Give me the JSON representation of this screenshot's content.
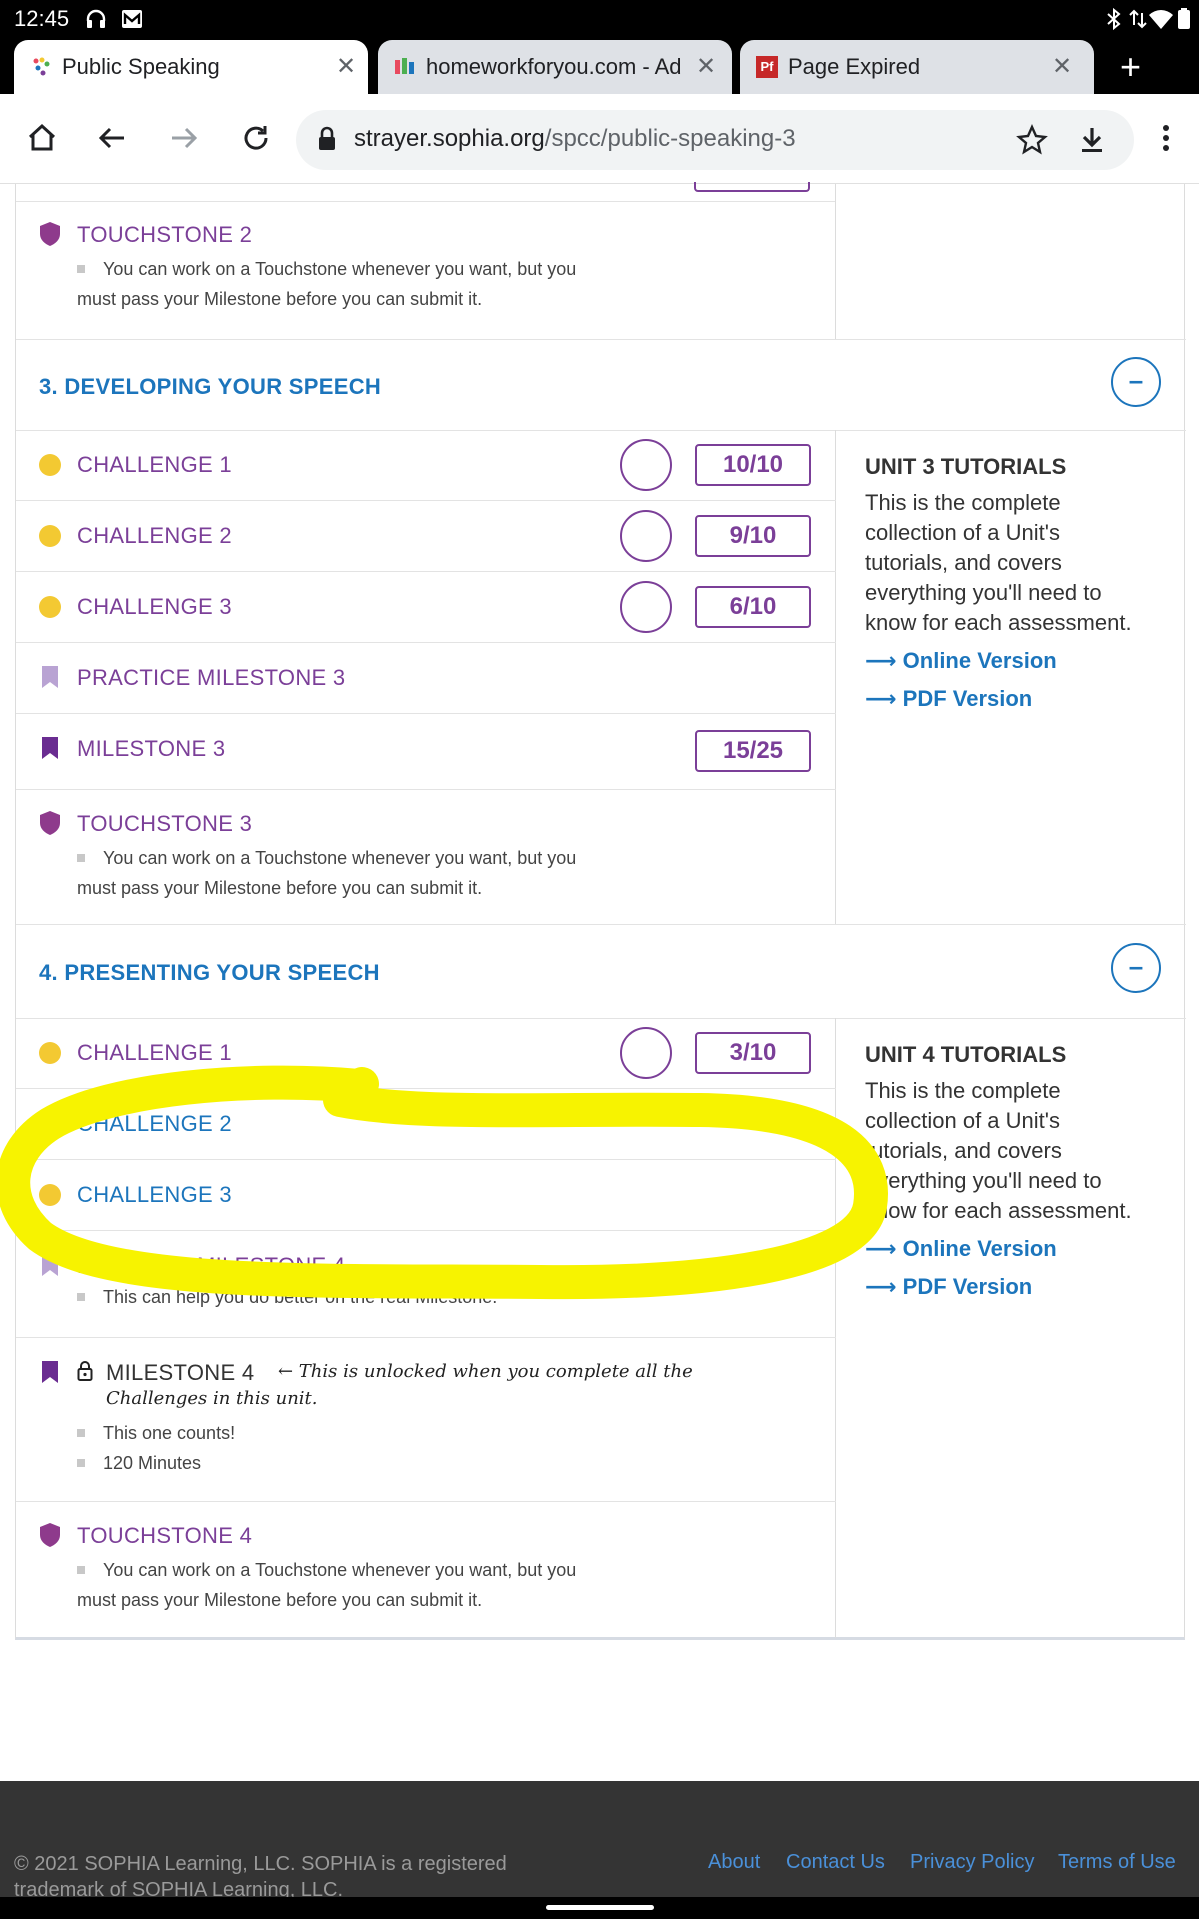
{
  "status": {
    "time": "12:45"
  },
  "tabs": [
    {
      "label": "Public Speaking",
      "active": true
    },
    {
      "label": "homeworkforyou.com - Add",
      "active": false
    },
    {
      "label": "Page Expired",
      "active": false,
      "favicon_text": "Pf"
    }
  ],
  "toolbar": {
    "url_domain": "strayer.sophia.org",
    "url_path": "/spcc/public-speaking-3"
  },
  "unit2": {
    "touchstone": {
      "title": "TOUCHSTONE 2",
      "note_line1": "You can work on a Touchstone whenever you want, but you",
      "note_line2": "must pass your Milestone before you can submit it."
    }
  },
  "unit3": {
    "heading": "3. DEVELOPING YOUR SPEECH",
    "collapse_label": "–",
    "items": [
      {
        "title": "CHALLENGE 1",
        "score": "10/10"
      },
      {
        "title": "CHALLENGE 2",
        "score": "9/10"
      },
      {
        "title": "CHALLENGE 3",
        "score": "6/10"
      },
      {
        "title": "PRACTICE MILESTONE 3"
      },
      {
        "title": "MILESTONE 3",
        "score": "15/25"
      }
    ],
    "touchstone": {
      "title": "TOUCHSTONE 3",
      "note_line1": "You can work on a Touchstone whenever you want, but you",
      "note_line2": "must pass your Milestone before you can submit it."
    },
    "tutorials": {
      "title": "UNIT 3 TUTORIALS",
      "desc_lines": [
        "This is the complete",
        "collection of a Unit's",
        "tutorials, and covers",
        "everything you'll need to",
        "know for each assessment."
      ],
      "online": "⟶ Online Version",
      "pdf": "⟶ PDF Version"
    }
  },
  "unit4": {
    "heading": "4. PRESENTING YOUR SPEECH",
    "collapse_label": "–",
    "items": [
      {
        "title": "CHALLENGE 1",
        "score": "3/10"
      },
      {
        "title": "CHALLENGE 2"
      },
      {
        "title": "CHALLENGE 3"
      }
    ],
    "practice": {
      "title": "PRACTICE MILESTONE 4",
      "note": "This can help you do better on the real Milestone."
    },
    "milestone": {
      "title": "MILESTONE 4",
      "annotation_line1": "← This is unlocked when you complete all the",
      "annotation_line2": "Challenges in this unit.",
      "note1": "This one counts!",
      "note2": "120 Minutes"
    },
    "touchstone": {
      "title": "TOUCHSTONE 4",
      "note_line1": "You can work on a Touchstone whenever you want, but you",
      "note_line2": "must pass your Milestone before you can submit it."
    },
    "tutorials": {
      "title": "UNIT 4 TUTORIALS",
      "desc_lines": [
        "This is the complete",
        "collection of a Unit's",
        "tutorials, and covers",
        "everything you'll need to",
        "know for each assessment."
      ],
      "online": "⟶ Online Version",
      "pdf": "⟶ PDF Version"
    }
  },
  "footer": {
    "copyright": "© 2021 SOPHIA Learning, LLC. SOPHIA is a registered trademark of SOPHIA Learning, LLC.",
    "links": [
      "About",
      "Contact Us",
      "Privacy Policy",
      "Terms of Use"
    ]
  },
  "colors": {
    "purple": "#7b3f98",
    "blue": "#1c75bc",
    "yellow_dot": "#f3c932",
    "highlight": "#f7f300",
    "footer_bg": "#343434"
  },
  "icons": [
    "headphones-icon",
    "gmail-icon",
    "bluetooth-icon",
    "data-icon",
    "wifi-icon",
    "battery-icon",
    "home-icon",
    "back-icon",
    "forward-icon",
    "reload-icon",
    "lock-icon",
    "star-icon",
    "download-icon",
    "menu-icon",
    "shield-icon",
    "bookmark-icon",
    "padlock-icon"
  ]
}
